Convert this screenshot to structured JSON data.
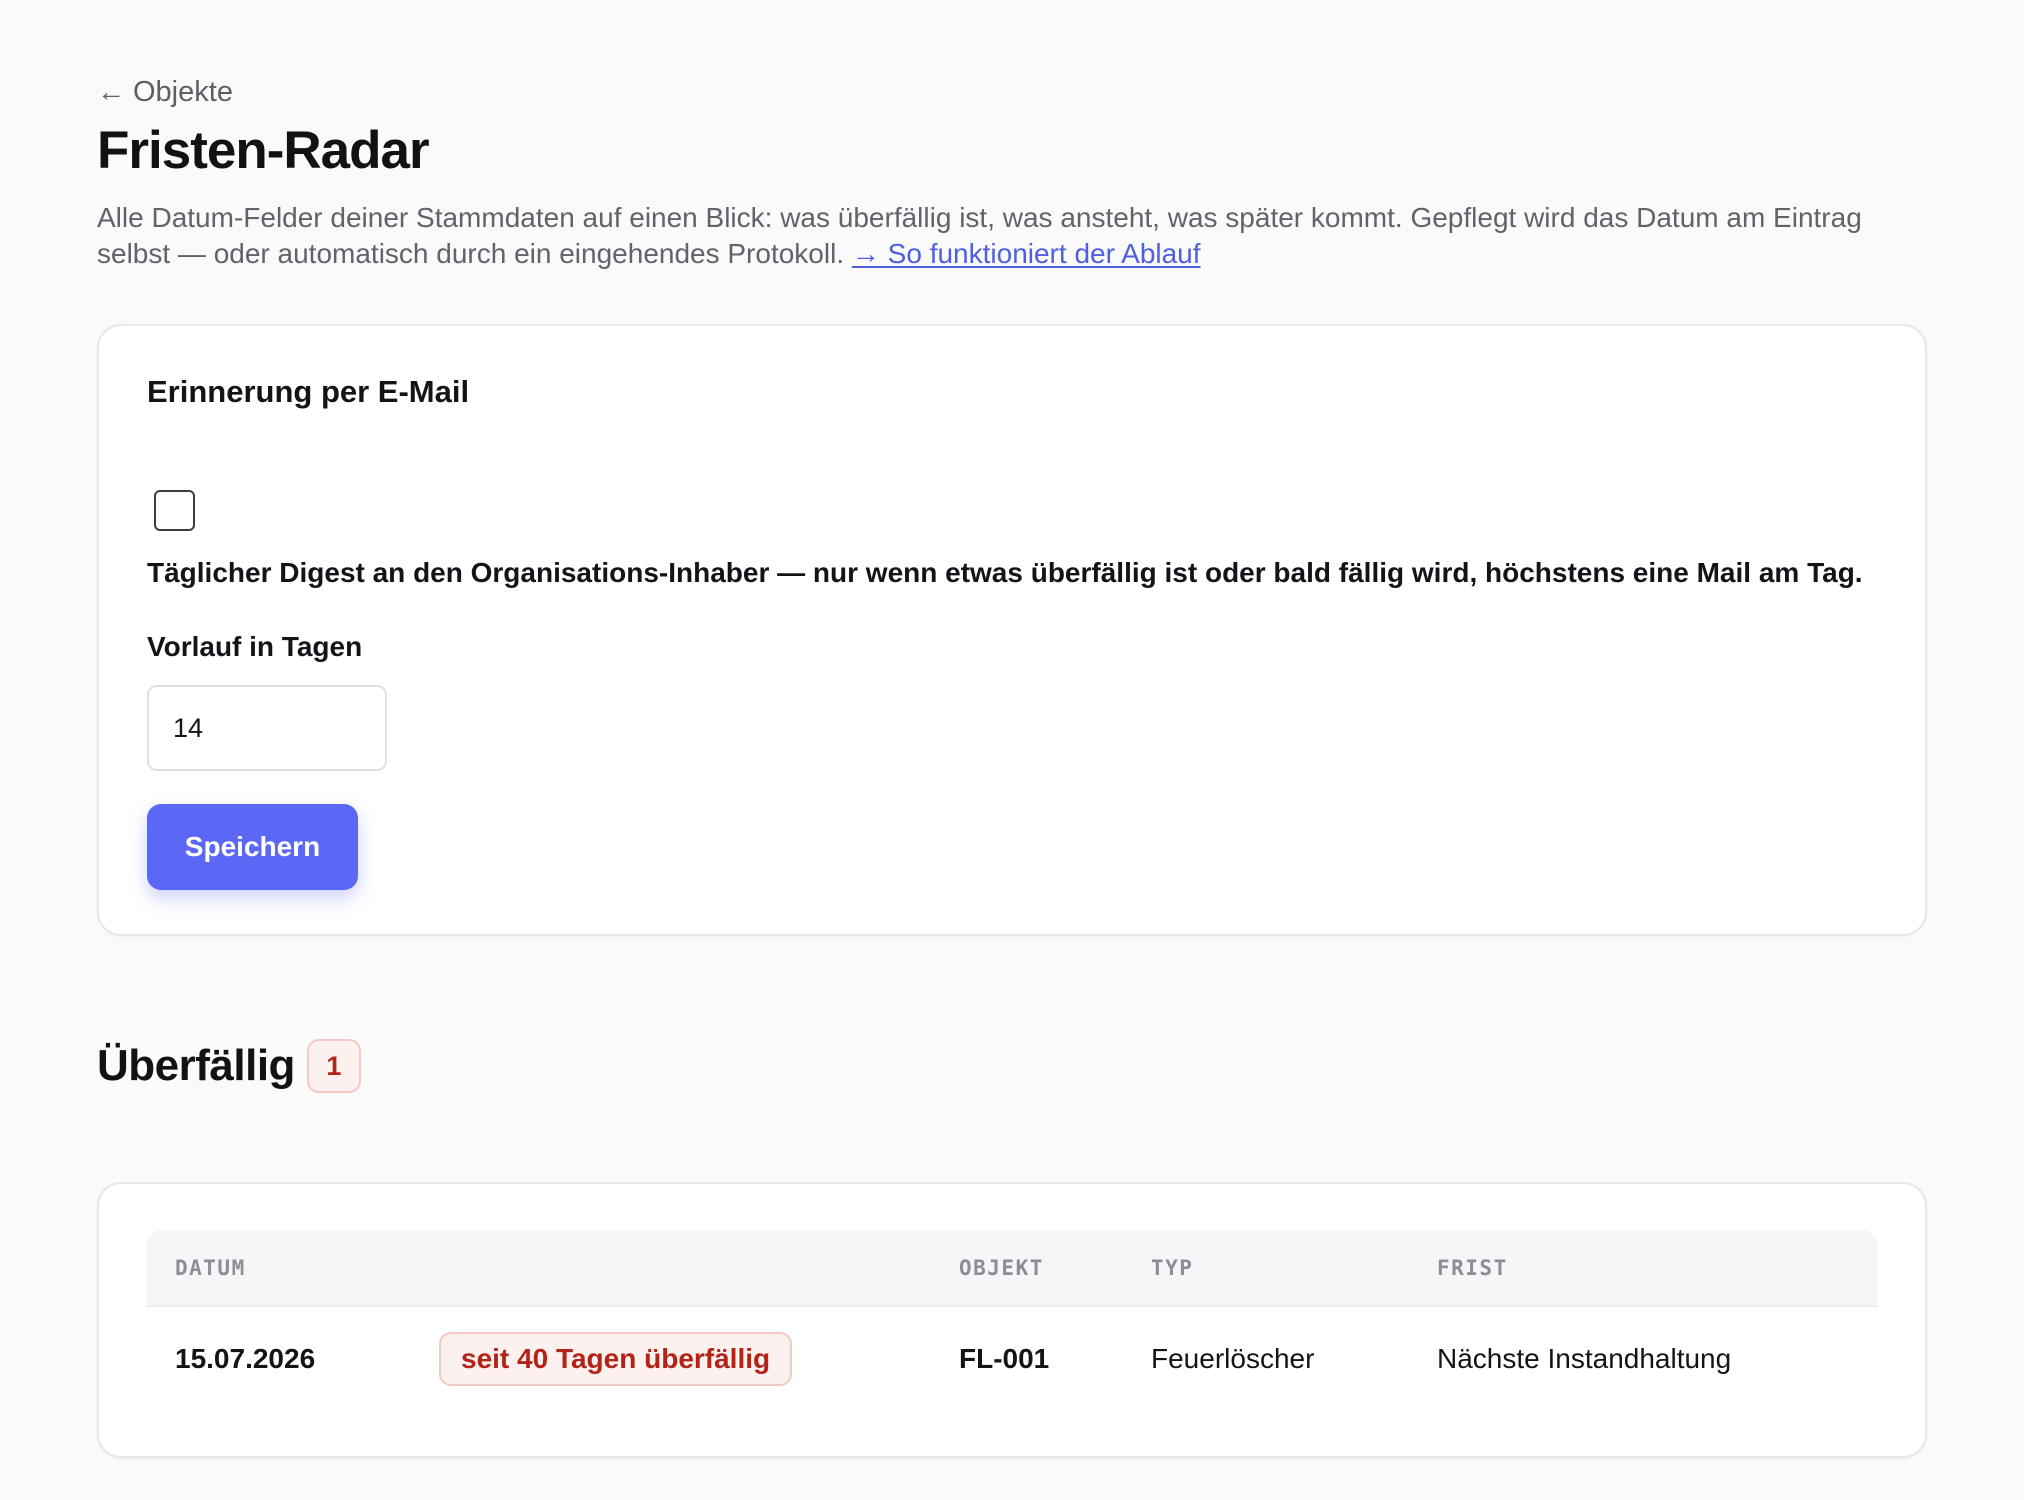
{
  "nav": {
    "back_arrow": "←",
    "back_label": "Objekte"
  },
  "page": {
    "title": "Fristen-Radar",
    "intro_text": "Alle Datum-Felder deiner Stammdaten auf einen Blick: was überfällig ist, was ansteht, was später kommt. Gepflegt wird das Datum am Eintrag selbst — oder automatisch durch ein eingehendes Protokoll.",
    "intro_link": "→ So funktioniert der Ablauf"
  },
  "reminder": {
    "title": "Erinnerung per E-Mail",
    "checkbox_checked": false,
    "checkbox_label": "Täglicher Digest an den Organisations-Inhaber — nur wenn etwas überfällig ist oder bald fällig wird, höchstens eine Mail am Tag.",
    "lead_days_label": "Vorlauf in Tagen",
    "lead_days_value": "14",
    "save_label": "Speichern"
  },
  "overdue": {
    "title": "Überfällig",
    "count": "1",
    "columns": {
      "date": "DATUM",
      "status": "",
      "object": "OBJEKT",
      "type": "TYP",
      "deadline": "FRIST"
    },
    "rows": [
      {
        "date": "15.07.2026",
        "status": "seit 40 Tagen überfällig",
        "object": "FL-001",
        "type": "Feuerlöscher",
        "deadline": "Nächste Instandhaltung"
      }
    ]
  },
  "colors": {
    "accent": "#5b68f5",
    "link": "#4f5fe0",
    "danger_text": "#b42318",
    "danger_bg": "#fdf1ef",
    "danger_border": "#f3c9c5",
    "page_bg": "#fafafa"
  }
}
